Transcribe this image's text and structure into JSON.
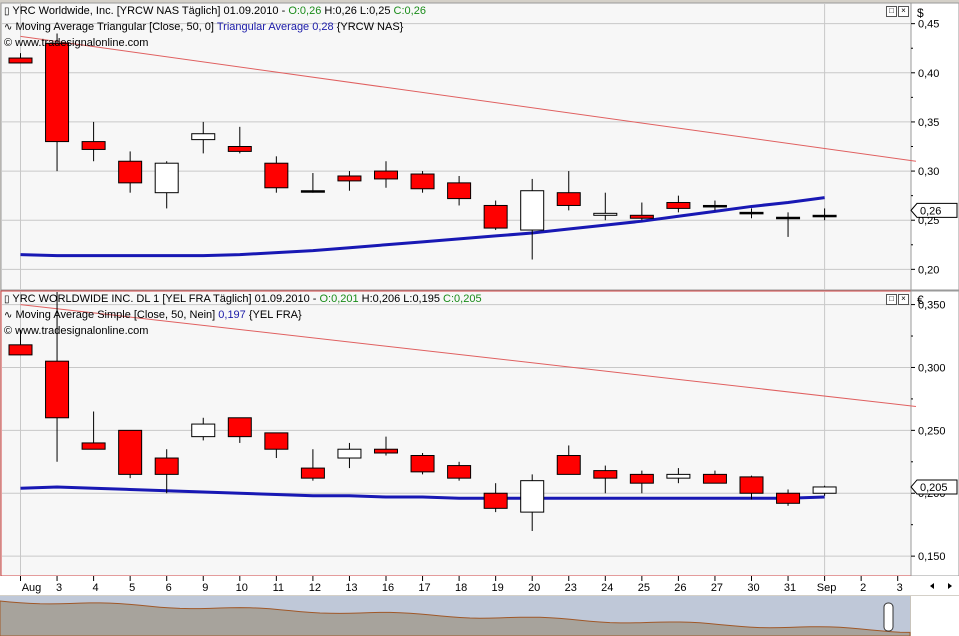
{
  "colors": {
    "up": "#ffffff",
    "down": "#ff0000",
    "ma": "#1818b4",
    "trend": "#e06060",
    "scrollbar": "#a05828"
  },
  "top": {
    "title": "YRC Worldwide, Inc. [YRCW NAS  Täglich] 01.09.2010 -",
    "o": "O:0,26",
    "h": "H:0,26",
    "l": "L:0,25",
    "c": "C:0,26",
    "ma_label": "Moving Average Triangular [Close, 50, 0]",
    "ma_value": "Triangular Average 0,28",
    "ma_tag": "{YRCW NAS}",
    "copyright": "© www.tradesignalonline.com",
    "currency": "$",
    "last_price_label": "0,26"
  },
  "bottom": {
    "title": "YRC WORLDWIDE INC.   DL 1 [YEL FRA  Täglich] 01.09.2010 -",
    "o": "O:0,201",
    "h": "H:0,206",
    "l": "L:0,195",
    "c": "C:0,205",
    "ma_label": "Moving Average Simple [Close, 50, Nein]",
    "ma_value": "0,197",
    "ma_tag": "{YEL FRA}",
    "copyright": "© www.tradesignalonline.com",
    "currency": "€",
    "last_price_label": "0,205"
  },
  "x_labels": [
    "Aug",
    "3",
    "4",
    "5",
    "6",
    "9",
    "10",
    "11",
    "12",
    "13",
    "16",
    "17",
    "18",
    "19",
    "20",
    "23",
    "24",
    "25",
    "26",
    "27",
    "30",
    "31",
    "Sep",
    "2",
    "3"
  ],
  "chart_data": [
    {
      "type": "candlestick",
      "title": "YRC Worldwide, Inc. [YRCW NAS  Täglich]",
      "ylim": [
        0.18,
        0.47
      ],
      "yticks": [
        0.2,
        0.25,
        0.3,
        0.35,
        0.4,
        0.45
      ],
      "ytick_labels": [
        "0,20",
        "0,25",
        "0,30",
        "0,35",
        "0,40",
        "0,45"
      ],
      "categories": [
        "2",
        "3",
        "4",
        "5",
        "6",
        "9",
        "10",
        "11",
        "12",
        "13",
        "16",
        "17",
        "18",
        "19",
        "20",
        "23",
        "24",
        "25",
        "26",
        "27",
        "30",
        "31",
        "Sep"
      ],
      "open": [
        0.415,
        0.43,
        0.33,
        0.31,
        0.278,
        0.332,
        0.325,
        0.308,
        0.28,
        0.295,
        0.3,
        0.297,
        0.288,
        0.265,
        0.24,
        0.278,
        0.255,
        0.255,
        0.268,
        0.265,
        0.258,
        0.253,
        0.255
      ],
      "high": [
        0.42,
        0.44,
        0.35,
        0.32,
        0.31,
        0.35,
        0.345,
        0.315,
        0.298,
        0.3,
        0.31,
        0.3,
        0.295,
        0.27,
        0.292,
        0.3,
        0.278,
        0.268,
        0.275,
        0.27,
        0.262,
        0.258,
        0.262
      ],
      "low": [
        0.41,
        0.3,
        0.31,
        0.278,
        0.262,
        0.318,
        0.318,
        0.278,
        0.278,
        0.28,
        0.283,
        0.278,
        0.265,
        0.24,
        0.21,
        0.26,
        0.25,
        0.25,
        0.258,
        0.26,
        0.252,
        0.233,
        0.25
      ],
      "close": [
        0.41,
        0.33,
        0.322,
        0.288,
        0.308,
        0.338,
        0.32,
        0.283,
        0.28,
        0.29,
        0.292,
        0.282,
        0.272,
        0.242,
        0.28,
        0.265,
        0.257,
        0.252,
        0.262,
        0.265,
        0.258,
        0.253,
        0.255
      ],
      "moving_average": {
        "name": "Triangular Average",
        "values": [
          0.215,
          0.214,
          0.214,
          0.214,
          0.214,
          0.214,
          0.215,
          0.217,
          0.219,
          0.222,
          0.225,
          0.228,
          0.231,
          0.234,
          0.237,
          0.241,
          0.245,
          0.249,
          0.254,
          0.259,
          0.264,
          0.268,
          0.273
        ]
      },
      "trendline": {
        "from": [
          0,
          0.437
        ],
        "to": [
          24.5,
          0.31
        ]
      },
      "last_value": 0.26
    },
    {
      "type": "candlestick",
      "title": "YRC WORLDWIDE INC.  DL 1 [YEL FRA  Täglich]",
      "ylim": [
        0.135,
        0.36
      ],
      "yticks": [
        0.15,
        0.2,
        0.25,
        0.3,
        0.35
      ],
      "ytick_labels": [
        "0,150",
        "0,200",
        "0,250",
        "0,300",
        "0,350"
      ],
      "categories": [
        "2",
        "3",
        "4",
        "5",
        "6",
        "9",
        "10",
        "11",
        "12",
        "13",
        "16",
        "17",
        "18",
        "19",
        "20",
        "23",
        "24",
        "25",
        "26",
        "27",
        "30",
        "31",
        "Sep"
      ],
      "open": [
        0.318,
        0.305,
        0.24,
        0.25,
        0.228,
        0.245,
        0.26,
        0.248,
        0.22,
        0.228,
        0.235,
        0.23,
        0.222,
        0.2,
        0.185,
        0.23,
        0.218,
        0.215,
        0.212,
        0.215,
        0.213,
        0.2,
        0.2
      ],
      "high": [
        0.33,
        0.36,
        0.265,
        0.25,
        0.235,
        0.26,
        0.26,
        0.248,
        0.235,
        0.24,
        0.245,
        0.232,
        0.225,
        0.208,
        0.215,
        0.238,
        0.222,
        0.218,
        0.22,
        0.218,
        0.214,
        0.203,
        0.206
      ],
      "low": [
        0.31,
        0.225,
        0.235,
        0.212,
        0.2,
        0.242,
        0.24,
        0.228,
        0.21,
        0.22,
        0.23,
        0.215,
        0.21,
        0.185,
        0.17,
        0.215,
        0.2,
        0.2,
        0.208,
        0.208,
        0.195,
        0.19,
        0.198
      ],
      "close": [
        0.31,
        0.26,
        0.235,
        0.215,
        0.215,
        0.255,
        0.245,
        0.235,
        0.212,
        0.235,
        0.232,
        0.217,
        0.212,
        0.188,
        0.21,
        0.215,
        0.212,
        0.208,
        0.215,
        0.208,
        0.2,
        0.192,
        0.205
      ],
      "moving_average": {
        "name": "Moving Average Simple",
        "values": [
          0.204,
          0.205,
          0.204,
          0.203,
          0.202,
          0.201,
          0.2,
          0.199,
          0.198,
          0.198,
          0.197,
          0.197,
          0.196,
          0.196,
          0.196,
          0.196,
          0.196,
          0.196,
          0.196,
          0.196,
          0.196,
          0.196,
          0.197
        ]
      },
      "trendline": {
        "from": [
          0,
          0.35
        ],
        "to": [
          24.5,
          0.269
        ]
      },
      "last_value": 0.205
    }
  ]
}
